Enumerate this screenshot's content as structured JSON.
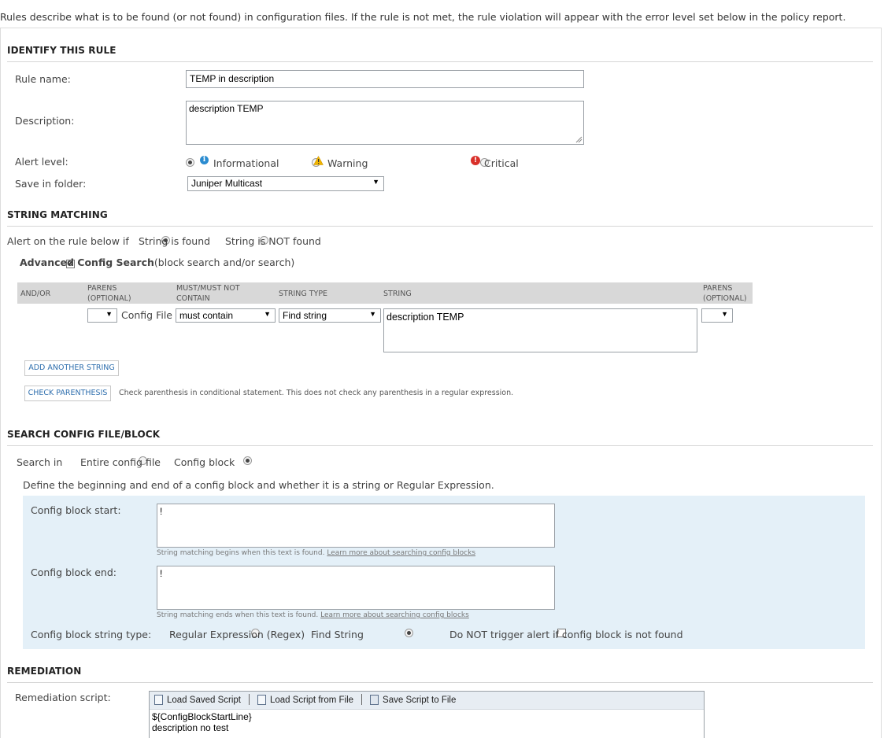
{
  "intro_text": "Rules describe what is to be found (or not found) in configuration files. If the rule is not met, the rule violation will appear with the error level set below in the policy report.",
  "identify": {
    "title": "IDENTIFY THIS RULE",
    "rule_name_label": "Rule name:",
    "rule_name_value": "TEMP in description",
    "description_label": "Description:",
    "description_value": "description TEMP",
    "alert_level_label": "Alert level:",
    "alert_levels": [
      {
        "label": "Informational",
        "selected": true,
        "icon": "info-icon"
      },
      {
        "label": "Warning",
        "selected": false,
        "icon": "warning-icon"
      },
      {
        "label": "Critical",
        "selected": false,
        "icon": "critical-icon"
      }
    ],
    "folder_label": "Save in folder:",
    "folder_value": "Juniper Multicast"
  },
  "string_matching": {
    "title": "STRING MATCHING",
    "alert_if_label": "Alert on the rule below if",
    "option_found": "String is found",
    "option_not_found": "String is NOT found",
    "advanced_label": "Advanced Config Search",
    "advanced_suffix": "(block search and/or search)",
    "advanced_checked": true,
    "columns": {
      "and_or": "AND/OR",
      "parens1_a": "PARENS",
      "parens1_b": "(OPTIONAL)",
      "must_a": "MUST/MUST NOT",
      "must_b": "CONTAIN",
      "string_type": "STRING TYPE",
      "string": "STRING",
      "parens2_a": "PARENS",
      "parens2_b": "(OPTIONAL)"
    },
    "row": {
      "target": "Config File",
      "must": "must contain",
      "string_type": "Find string",
      "string": "description TEMP"
    },
    "add_button": "ADD ANOTHER STRING",
    "check_button": "CHECK PARENTHESIS",
    "check_note": "Check parenthesis in conditional statement. This does not check any parenthesis in a regular expression."
  },
  "search_block": {
    "title": "SEARCH CONFIG FILE/BLOCK",
    "search_in_label": "Search in",
    "option_entire": "Entire config file",
    "option_block": "Config block",
    "define_text": "Define the beginning and end of a config block and whether it is a string or Regular Expression.",
    "start_label": "Config block start:",
    "start_value": "!",
    "start_hint": "String matching begins when this text is found.",
    "learn_more": "Learn more about searching config blocks",
    "end_label": "Config block end:",
    "end_value": "!",
    "end_hint": "String matching ends when this text is found.",
    "type_label": "Config block string type:",
    "option_regex": "Regular Expression (Regex)",
    "option_find": "Find String",
    "no_trigger_label": "Do NOT trigger alert if config block is not found"
  },
  "remediation": {
    "title": "REMEDIATION",
    "script_label": "Remediation script:",
    "toolbar": {
      "load_saved": "Load Saved Script",
      "load_file": "Load Script from File",
      "save_file": "Save Script to File"
    },
    "script_line1": "${ConfigBlockStartLine}",
    "script_line2": "description no test"
  }
}
